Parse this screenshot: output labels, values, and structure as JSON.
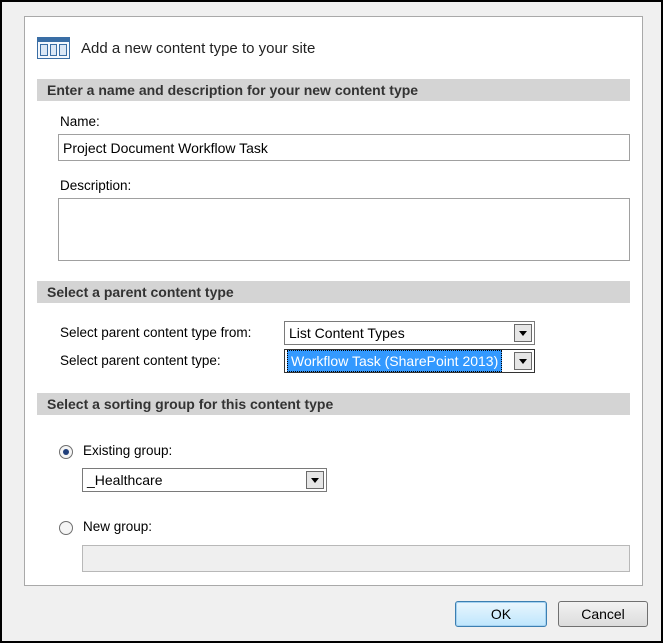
{
  "dialog": {
    "title": "Add a new content type to your site",
    "title_icon": "content-type-icon"
  },
  "name_section": {
    "heading": "Enter a name and description for your new content type",
    "name_label": "Name:",
    "name_value": "Project Document Workflow Task",
    "description_label": "Description:",
    "description_value": ""
  },
  "parent_section": {
    "heading": "Select a parent content type",
    "from_label": "Select parent content type from:",
    "from_value": "List Content Types",
    "type_label": "Select parent content type:",
    "type_value": "Workflow Task (SharePoint 2013)"
  },
  "group_section": {
    "heading": "Select a sorting group for this content type",
    "existing_label": "Existing group:",
    "existing_checked": true,
    "existing_value": "_Healthcare",
    "new_label": "New group:",
    "new_checked": false,
    "new_value": ""
  },
  "buttons": {
    "ok": "OK",
    "cancel": "Cancel"
  },
  "colors": {
    "section_bg": "#d4d4d4",
    "selection": "#3399ff",
    "default_button_border": "#3c7fb1"
  }
}
